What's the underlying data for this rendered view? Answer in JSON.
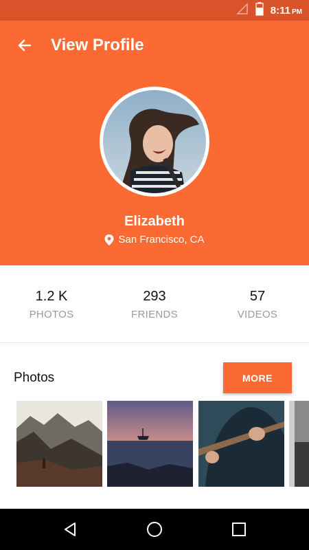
{
  "status_bar": {
    "time": "8:11",
    "ampm": "PM",
    "icons": [
      "signal-icon",
      "battery-icon"
    ]
  },
  "appbar": {
    "title": "View Profile",
    "back_icon": "arrow-left-icon"
  },
  "profile": {
    "name": "Elizabeth",
    "location": "San Francisco, CA",
    "location_icon": "location-pin-icon"
  },
  "stats": [
    {
      "value": "1.2 K",
      "label": "PHOTOS"
    },
    {
      "value": "293",
      "label": "FRIENDS"
    },
    {
      "value": "57",
      "label": "VIDEOS"
    }
  ],
  "photos": {
    "title": "Photos",
    "more_label": "MORE"
  },
  "nav": {
    "icons": [
      "back-triangle-icon",
      "home-circle-icon",
      "recents-square-icon"
    ]
  },
  "colors": {
    "accent": "#fb6a33",
    "status_bar": "#d9532a",
    "nav_bar": "#000000"
  }
}
